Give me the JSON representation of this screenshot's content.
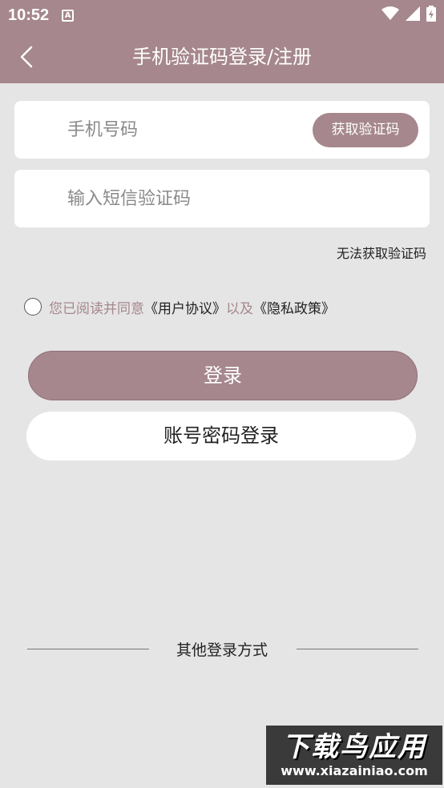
{
  "status": {
    "time": "10:52",
    "notification_glyph": "A"
  },
  "header": {
    "title": "手机验证码登录/注册"
  },
  "form": {
    "phone_placeholder": "手机号码",
    "get_code_label": "获取验证码",
    "sms_placeholder": "输入短信验证码",
    "cant_get_code_label": "无法获取验证码"
  },
  "agreement": {
    "prefix": "您已阅读并同意",
    "user_agreement": "《用户协议》",
    "conjunction": "以及",
    "privacy_policy": "《隐私政策》"
  },
  "buttons": {
    "login_label": "登录",
    "password_login_label": "账号密码登录"
  },
  "other": {
    "label": "其他登录方式"
  },
  "watermark": {
    "main": "下载鸟应用",
    "url": "www.xiazainiao.com"
  },
  "colors": {
    "accent": "#a5878d",
    "background": "#e5e5e5",
    "card": "#ffffff"
  }
}
